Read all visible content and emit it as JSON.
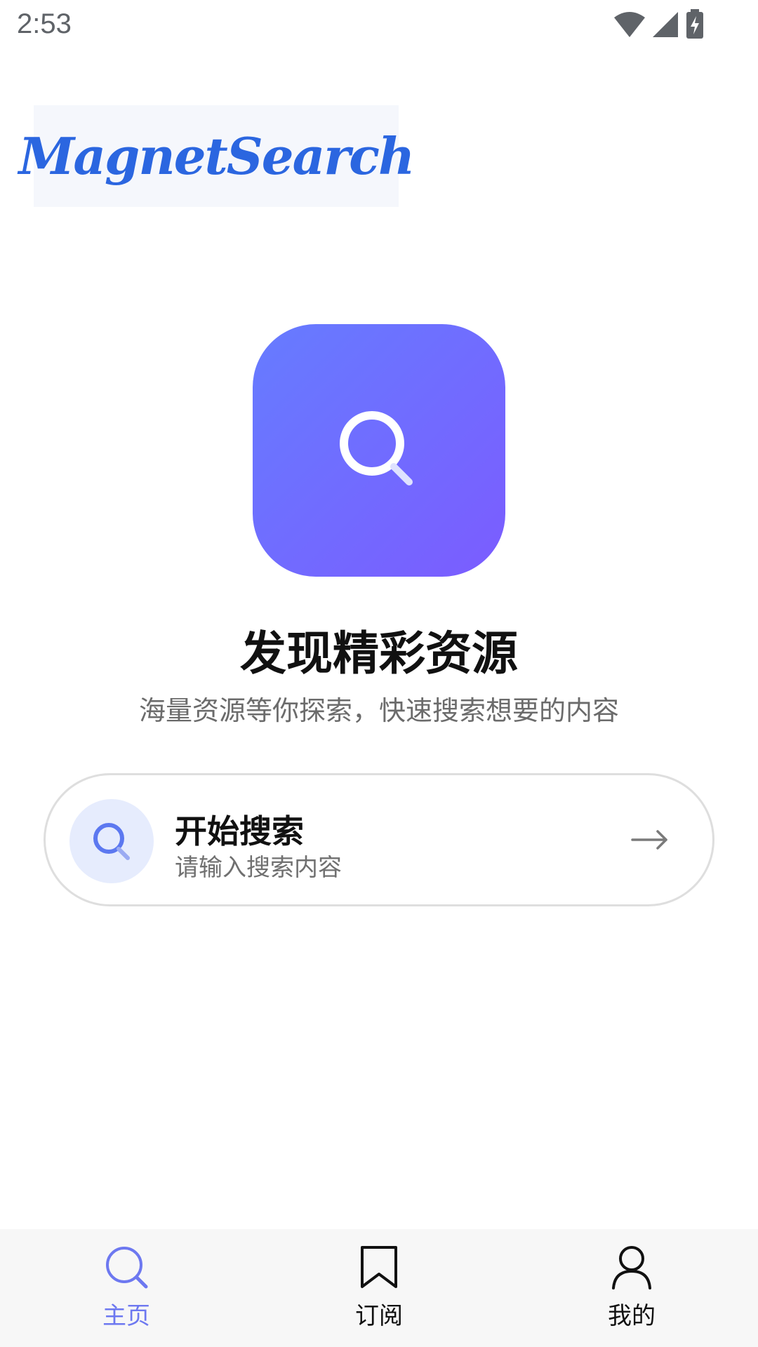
{
  "status_bar": {
    "time": "2:53"
  },
  "logo": {
    "text": "MagnetSearch"
  },
  "hero": {
    "title": "发现精彩资源",
    "subtitle": "海量资源等你探索，快速搜索想要的内容"
  },
  "search_card": {
    "title": "开始搜索",
    "hint": "请输入搜索内容",
    "arrow": "→"
  },
  "bottom_nav": {
    "items": [
      {
        "label": "主页",
        "icon": "search-icon",
        "active": true
      },
      {
        "label": "订阅",
        "icon": "bookmark-icon",
        "active": false
      },
      {
        "label": "我的",
        "icon": "person-icon",
        "active": false
      }
    ]
  },
  "colors": {
    "accent": "#6d78f0",
    "hero_gradient_start": "#667cff",
    "hero_gradient_end": "#7b5cff",
    "logo_blue": "#2b66e0",
    "search_icon_bg": "#e6ecfd"
  }
}
